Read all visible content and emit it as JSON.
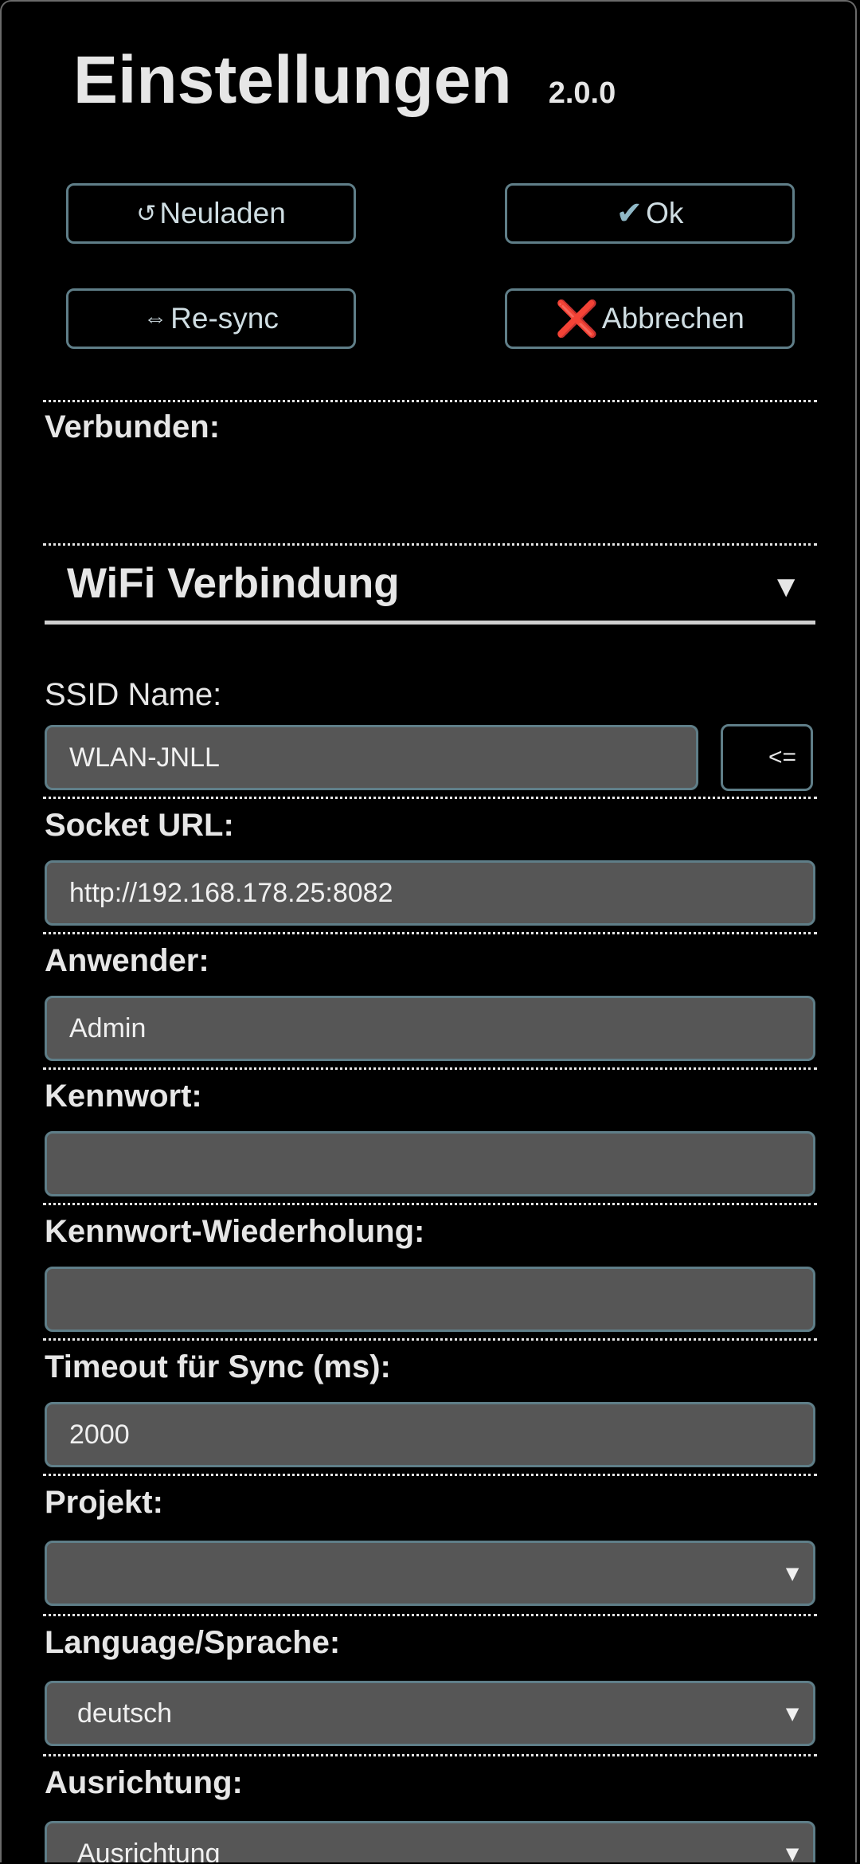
{
  "header": {
    "title": "Einstellungen",
    "version": "2.0.0"
  },
  "toolbar": {
    "reload_icon": "↺",
    "reload_label": "Neuladen",
    "ok_icon": "✔",
    "ok_label": "Ok",
    "resync_icon": "⇔",
    "resync_label": "Re-sync",
    "cancel_icon": "❌",
    "cancel_label": "Abbrechen"
  },
  "status": {
    "connected_label": "Verbunden:"
  },
  "wifi_section": {
    "title": "WiFi Verbindung",
    "toggle_glyph": "▼",
    "ssid_label": "SSID Name:",
    "ssid_value": "WLAN-JNLL",
    "ssid_copy_label": "<="
  },
  "fields": {
    "socket_url_label": "Socket URL:",
    "socket_url_value": "http://192.168.178.25:8082",
    "user_label": "Anwender:",
    "user_value": "Admin",
    "password_label": "Kennwort:",
    "password_value": "",
    "password_repeat_label": "Kennwort-Wiederholung:",
    "password_repeat_value": "",
    "timeout_label": "Timeout für Sync (ms):",
    "timeout_value": "2000",
    "project_label": "Projekt:",
    "project_value": "",
    "language_label": "Language/Sprache:",
    "language_value": "deutsch",
    "orientation_label": "Ausrichtung:",
    "orientation_value": "Ausrichtung",
    "select_caret": "▼"
  },
  "colors": {
    "background": "#000000",
    "input_fill": "#565656",
    "input_border": "#5f7e88",
    "cancel_icon": "#e0201a"
  }
}
